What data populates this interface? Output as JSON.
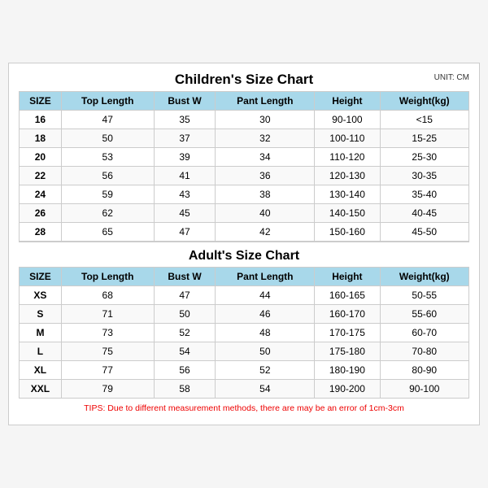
{
  "chart": {
    "main_title": "Children's Size Chart",
    "unit": "UNIT: CM",
    "children": {
      "headers": [
        "SIZE",
        "Top Length",
        "Bust W",
        "Pant Length",
        "Height",
        "Weight(kg)"
      ],
      "rows": [
        [
          "16",
          "47",
          "35",
          "30",
          "90-100",
          "<15"
        ],
        [
          "18",
          "50",
          "37",
          "32",
          "100-110",
          "15-25"
        ],
        [
          "20",
          "53",
          "39",
          "34",
          "110-120",
          "25-30"
        ],
        [
          "22",
          "56",
          "41",
          "36",
          "120-130",
          "30-35"
        ],
        [
          "24",
          "59",
          "43",
          "38",
          "130-140",
          "35-40"
        ],
        [
          "26",
          "62",
          "45",
          "40",
          "140-150",
          "40-45"
        ],
        [
          "28",
          "65",
          "47",
          "42",
          "150-160",
          "45-50"
        ]
      ]
    },
    "adult_title": "Adult's Size Chart",
    "adult": {
      "headers": [
        "SIZE",
        "Top Length",
        "Bust W",
        "Pant Length",
        "Height",
        "Weight(kg)"
      ],
      "rows": [
        [
          "XS",
          "68",
          "47",
          "44",
          "160-165",
          "50-55"
        ],
        [
          "S",
          "71",
          "50",
          "46",
          "160-170",
          "55-60"
        ],
        [
          "M",
          "73",
          "52",
          "48",
          "170-175",
          "60-70"
        ],
        [
          "L",
          "75",
          "54",
          "50",
          "175-180",
          "70-80"
        ],
        [
          "XL",
          "77",
          "56",
          "52",
          "180-190",
          "80-90"
        ],
        [
          "XXL",
          "79",
          "58",
          "54",
          "190-200",
          "90-100"
        ]
      ]
    },
    "tips": "TIPS: Due to different measurement methods, there are may be an error of 1cm-3cm"
  }
}
